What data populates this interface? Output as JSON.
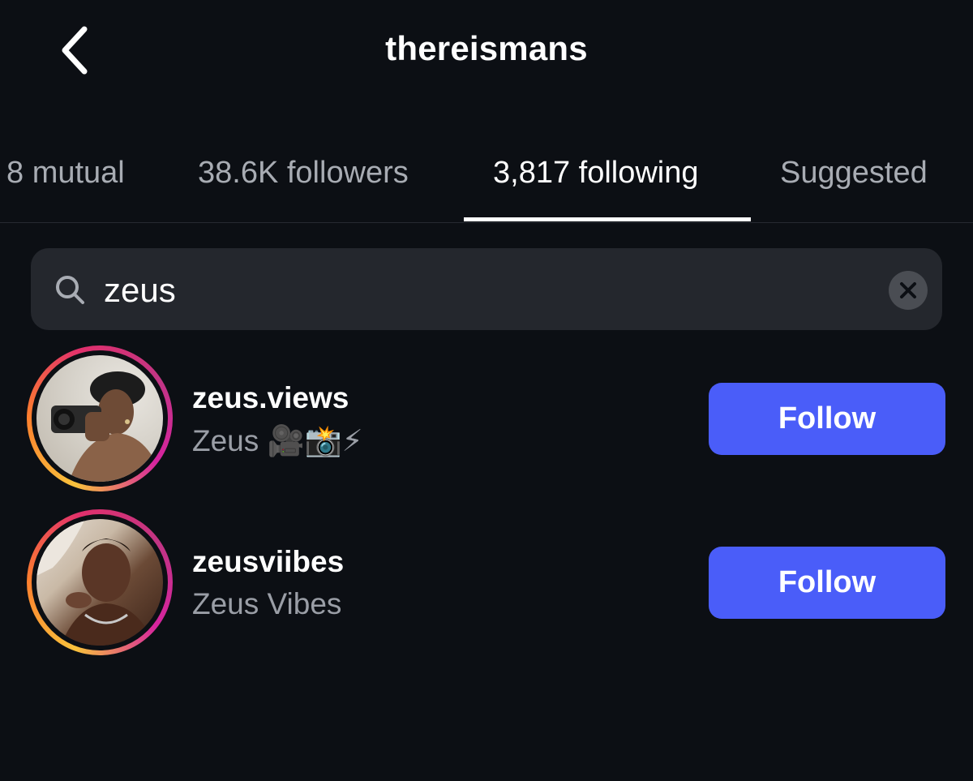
{
  "header": {
    "title": "thereismans",
    "back_icon": "chevron-left-icon"
  },
  "tabs": [
    {
      "label": "8 mutual",
      "active": false
    },
    {
      "label": "38.6K followers",
      "active": false
    },
    {
      "label": "3,817 following",
      "active": true
    },
    {
      "label": "Suggested",
      "active": false
    }
  ],
  "search": {
    "value": "zeus",
    "icon": "search-icon",
    "clear_icon": "clear-icon"
  },
  "results": [
    {
      "username": "zeus.views",
      "full_name": "Zeus 🎥📸⚡",
      "button_label": "Follow"
    },
    {
      "username": "zeusviibes",
      "full_name": "Zeus Vibes",
      "button_label": "Follow"
    }
  ],
  "colors": {
    "background": "#0c0f14",
    "search_bg": "#24272d",
    "follow_button": "#4a5df9",
    "inactive_tab": "#a8acb3",
    "secondary_text": "#9a9ea6"
  }
}
